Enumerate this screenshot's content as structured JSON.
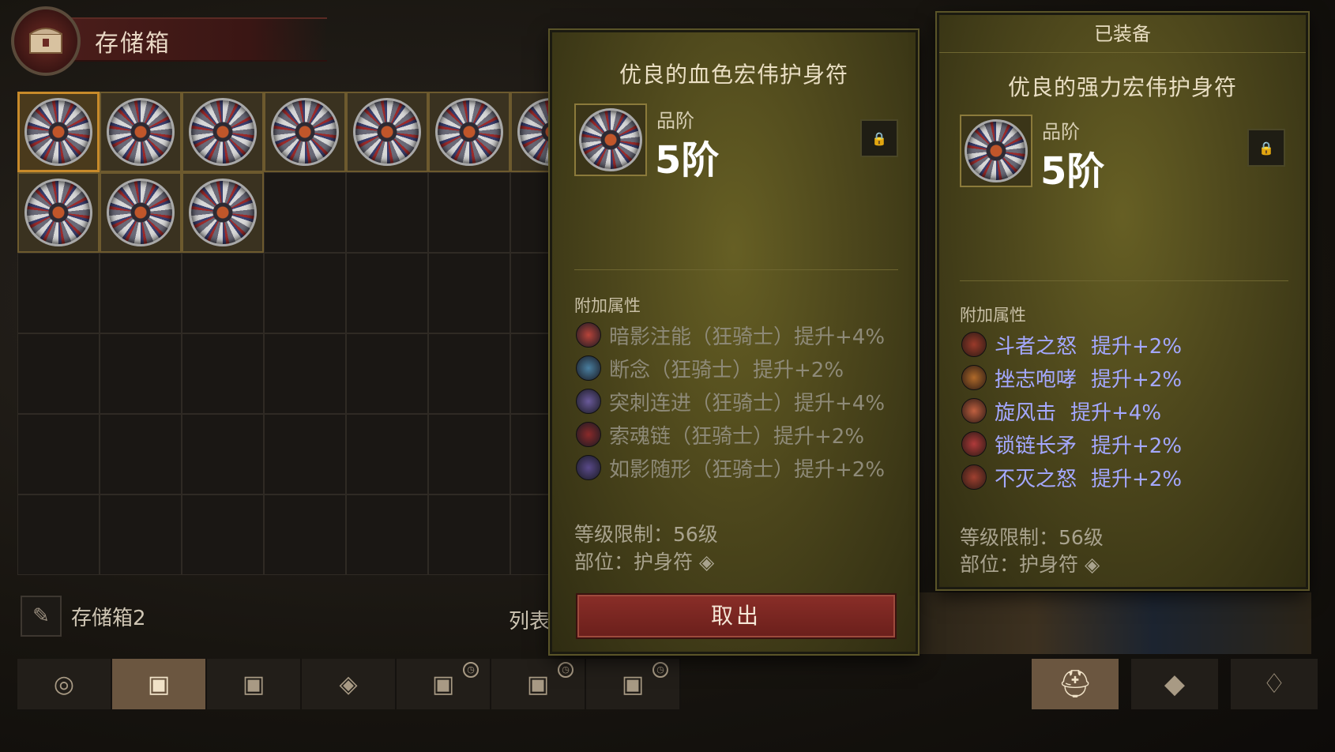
{
  "header": {
    "title": "存储箱"
  },
  "grid": {
    "filled_count": 10,
    "selected_index": 0
  },
  "storage": {
    "name": "存储箱2",
    "list_label": "列表"
  },
  "tabs": [
    {
      "icon": "coins-icon"
    },
    {
      "icon": "chest-icon"
    },
    {
      "icon": "chest-icon"
    },
    {
      "icon": "gem-icon"
    },
    {
      "icon": "locked-chest-icon"
    },
    {
      "icon": "locked-chest-icon"
    },
    {
      "icon": "locked-chest-icon"
    }
  ],
  "right_tabs": [
    {
      "icon": "helmet-icon"
    },
    {
      "icon": "material-icon"
    },
    {
      "icon": "bag-icon"
    }
  ],
  "item_left": {
    "name": "优良的血色宏伟护身符",
    "tier_label": "品阶",
    "tier_value": "5阶",
    "section_label": "附加属性",
    "attributes": [
      {
        "text": "暗影注能（狂骑士）提升+4%",
        "color": "#b8443a"
      },
      {
        "text": "断念（狂骑士）提升+2%",
        "color": "#4a7fa0"
      },
      {
        "text": "突刺连进（狂骑士）提升+4%",
        "color": "#6a5a9a"
      },
      {
        "text": "索魂链（狂骑士）提升+2%",
        "color": "#8a2a2a"
      },
      {
        "text": "如影随形（狂骑士）提升+2%",
        "color": "#5a4a8a"
      }
    ],
    "level_req": "等级限制：56级",
    "slot": "部位：护身符",
    "action_button": "取出"
  },
  "item_right": {
    "header": "已装备",
    "name": "优良的强力宏伟护身符",
    "tier_label": "品阶",
    "tier_value": "5阶",
    "section_label": "附加属性",
    "attributes": [
      {
        "skill": "斗者之怒",
        "bonus": "提升+2%",
        "color": "#9a3a2a"
      },
      {
        "skill": "挫志咆哮",
        "bonus": "提升+2%",
        "color": "#b06a2a"
      },
      {
        "skill": "旋风击",
        "bonus": "提升+4%",
        "color": "#c06040"
      },
      {
        "skill": "锁链长矛",
        "bonus": "提升+2%",
        "color": "#b03a3a"
      },
      {
        "skill": "不灭之怒",
        "bonus": "提升+2%",
        "color": "#a04030"
      }
    ],
    "level_req": "等级限制：56级",
    "slot": "部位：护身符"
  }
}
